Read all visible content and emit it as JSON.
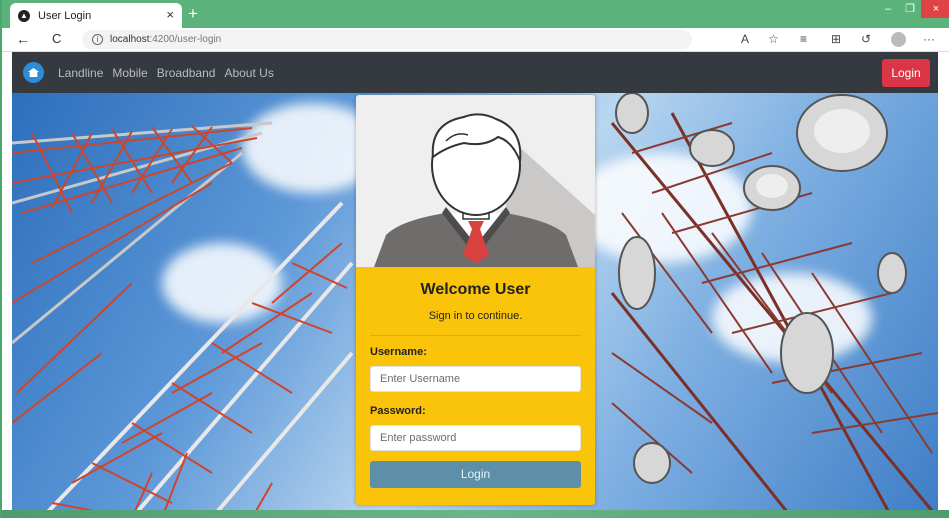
{
  "browser": {
    "tab_title": "User Login",
    "tab_close": "×",
    "new_tab": "+",
    "url_host": "localhost",
    "url_path": ":4200/user-login",
    "info_icon": "i",
    "minimize": "–",
    "maximize": "❐",
    "close": "×",
    "more": "···",
    "icons": {
      "back": "←",
      "refresh": "C",
      "read_aloud": "A",
      "favorite": "☆",
      "favorites": "≡",
      "collections": "⊞",
      "history": "↺"
    }
  },
  "navbar": {
    "links": [
      "Landline",
      "Mobile",
      "Broadband",
      "About Us"
    ],
    "login_label": "Login"
  },
  "card": {
    "welcome": "Welcome User",
    "subtitle": "Sign in to continue.",
    "username_label": "Username:",
    "username_placeholder": "Enter Username",
    "password_label": "Password:",
    "password_placeholder": "Enter password",
    "login_button": "Login"
  },
  "colors": {
    "navbar_bg": "#343a40",
    "login_danger": "#dc3545",
    "card_yellow": "#f9c40a",
    "login_button": "#5e8fa8",
    "tab_strip": "#5bb37b"
  }
}
